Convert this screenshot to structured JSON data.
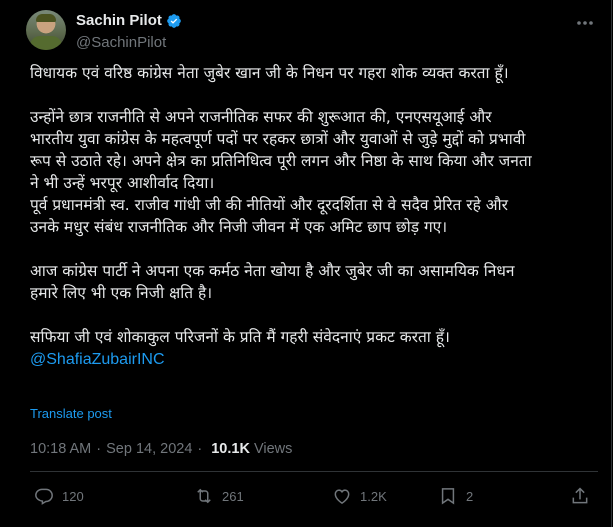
{
  "author": {
    "name": "Sachin Pilot",
    "handle": "@SachinPilot",
    "verified": true
  },
  "post": {
    "paragraphs": [
      "विधायक एवं वरिष्ठ कांग्रेस नेता जुबेर खान जी के निधन पर गहरा शोक व्यक्त करता हूँ।",
      "",
      "उन्होंने छात्र राजनीति से अपने राजनीतिक सफर की शुरूआत की, एनएसयूआई और\nभारतीय युवा कांग्रेस के महत्वपूर्ण पदों पर रहकर छात्रों और युवाओं से जुड़े मुद्दों को प्रभावी\nरूप से उठाते रहे। अपने क्षेत्र का प्रतिनिधित्व पूरी लगन और निष्ठा के साथ किया और जनता\nने भी उन्हें भरपूर आशीर्वाद दिया।\nपूर्व प्रधानमंत्री स्व. राजीव गांधी जी की नीतियों और दूरदर्शिता से वे सदैव प्रेरित रहे और\nउनके मधुर संबंध राजनीतिक और निजी जीवन में एक अमिट छाप छोड़ गए।",
      "",
      "आज कांग्रेस पार्टी ने अपना एक कर्मठ नेता खोया है और जुबेर जी का असामयिक निधन\nहमारे लिए भी एक निजी क्षति है।",
      "",
      "सफिया जी एवं शोकाकुल परिजनों के प्रति मैं गहरी संवेदनाएं प्रकट करता हूँ।"
    ],
    "mention": "@ShafiaZubairINC",
    "translate_label": "Translate post",
    "time": "10:18 AM",
    "date": "Sep 14, 2024",
    "views_count": "10.1K",
    "views_label": "Views"
  },
  "actions": {
    "replies": "120",
    "reposts": "261",
    "likes": "1.2K",
    "bookmarks": "2"
  },
  "colors": {
    "background": "#000000",
    "text": "#e7e9ea",
    "muted": "#71767b",
    "accent": "#1d9bf0"
  }
}
